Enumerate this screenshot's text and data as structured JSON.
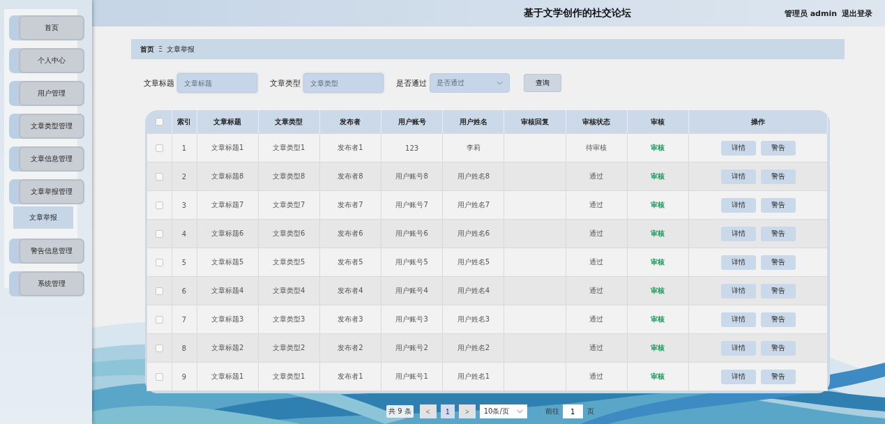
{
  "header": {
    "title": "基于文学创作的社交论坛",
    "user": "管理员 admin",
    "logout": "退出登录"
  },
  "sidebar": {
    "items": [
      {
        "label": "首页",
        "selected": false
      },
      {
        "label": "个人中心",
        "selected": false
      },
      {
        "label": "用户管理",
        "selected": false
      },
      {
        "label": "文章类型管理",
        "selected": false
      },
      {
        "label": "文章信息管理",
        "selected": false
      },
      {
        "label": "文章举报管理",
        "selected": false,
        "children": [
          {
            "label": "文章举报",
            "selected": true
          }
        ]
      },
      {
        "label": "警告信息管理",
        "selected": false
      },
      {
        "label": "系统管理",
        "selected": false
      }
    ]
  },
  "breadcrumb": {
    "items": [
      "首页",
      "文章举报"
    ],
    "separator": "Ξ"
  },
  "filters": [
    {
      "kind": "input",
      "label": "文章标题",
      "placeholder": "文章标题"
    },
    {
      "kind": "input",
      "label": "文章类型",
      "placeholder": "文章类型"
    },
    {
      "kind": "select",
      "label": "是否通过",
      "placeholder": "是否通过"
    }
  ],
  "search_button": "查询",
  "table": {
    "select_all_checked": false,
    "columns": [
      "索引",
      "文章标题",
      "文章类型",
      "发布者",
      "用户账号",
      "用户姓名",
      "审核回复",
      "审核状态",
      "审核",
      "操作"
    ],
    "rows": [
      {
        "checked": false,
        "index": "1",
        "title": "文章标题1",
        "type": "文章类型1",
        "publisher": "发布者1",
        "account": "123",
        "name": "李莉",
        "status": "待审核",
        "audit": "审核",
        "actions": [
          "详情",
          "警告"
        ]
      },
      {
        "checked": false,
        "index": "2",
        "title": "文章标题8",
        "type": "文章类型8",
        "publisher": "发布者8",
        "account": "用户账号8",
        "name": "用户姓名8",
        "status": "通过",
        "audit": "审核",
        "actions": [
          "详情",
          "警告"
        ]
      },
      {
        "checked": false,
        "index": "3",
        "title": "文章标题7",
        "type": "文章类型7",
        "publisher": "发布者7",
        "account": "用户账号7",
        "name": "用户姓名7",
        "status": "通过",
        "audit": "审核",
        "actions": [
          "详情",
          "警告"
        ]
      },
      {
        "checked": false,
        "index": "4",
        "title": "文章标题6",
        "type": "文章类型6",
        "publisher": "发布者6",
        "account": "用户账号6",
        "name": "用户姓名6",
        "status": "通过",
        "audit": "审核",
        "actions": [
          "详情",
          "警告"
        ]
      },
      {
        "checked": false,
        "index": "5",
        "title": "文章标题5",
        "type": "文章类型5",
        "publisher": "发布者5",
        "account": "用户账号5",
        "name": "用户姓名5",
        "status": "通过",
        "audit": "审核",
        "actions": [
          "详情",
          "警告"
        ]
      },
      {
        "checked": false,
        "index": "6",
        "title": "文章标题4",
        "type": "文章类型4",
        "publisher": "发布者4",
        "account": "用户账号4",
        "name": "用户姓名4",
        "status": "通过",
        "audit": "审核",
        "actions": [
          "详情",
          "警告"
        ]
      },
      {
        "checked": false,
        "index": "7",
        "title": "文章标题3",
        "type": "文章类型3",
        "publisher": "发布者3",
        "account": "用户账号3",
        "name": "用户姓名3",
        "status": "通过",
        "audit": "审核",
        "actions": [
          "详情",
          "警告"
        ]
      },
      {
        "checked": false,
        "index": "8",
        "title": "文章标题2",
        "type": "文章类型2",
        "publisher": "发布者2",
        "account": "用户账号2",
        "name": "用户姓名2",
        "status": "通过",
        "audit": "审核",
        "actions": [
          "详情",
          "警告"
        ]
      },
      {
        "checked": false,
        "index": "9",
        "title": "文章标题1",
        "type": "文章类型1",
        "publisher": "发布者1",
        "account": "用户账号1",
        "name": "用户姓名1",
        "status": "通过",
        "audit": "审核",
        "actions": [
          "详情",
          "警告"
        ]
      }
    ]
  },
  "pagination": {
    "total": "共 9 条",
    "prev": "<",
    "pages": [
      {
        "label": "1",
        "selected": true
      }
    ],
    "next": ">",
    "page_size": "10条/页",
    "goto_label": "前往",
    "goto_value": "1",
    "goto_suffix": "页"
  }
}
